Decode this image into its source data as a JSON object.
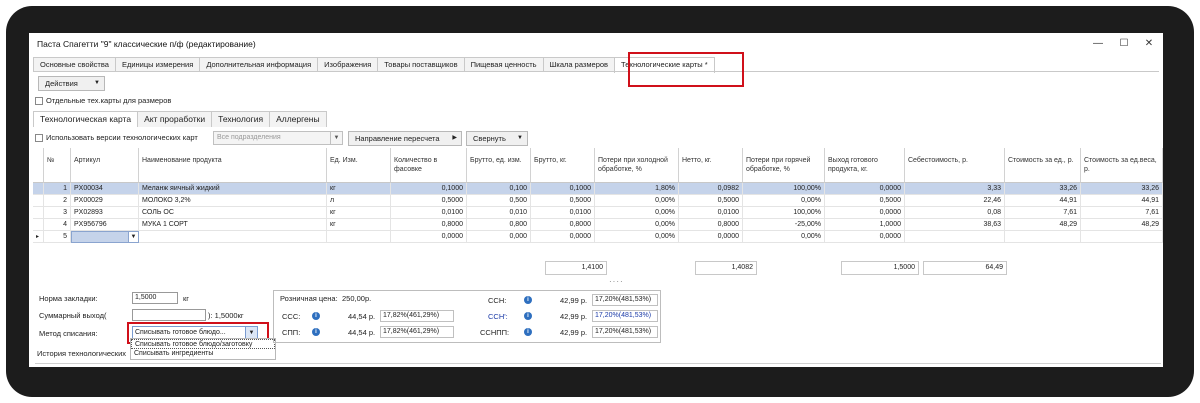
{
  "window": {
    "title": "Паста Спагетти \"9\" классические п/ф (редактирование)",
    "minimize": "—",
    "maximize": "☐",
    "close": "✕"
  },
  "tabs": [
    "Основные свойства",
    "Единицы измерения",
    "Дополнительная информация",
    "Изображения",
    "Товары поставщиков",
    "Пищевая ценность",
    "Шкала размеров",
    "Технологические карты *"
  ],
  "actions_label": "Действия",
  "size_cards_label": "Отдельные тех.карты для размеров",
  "subtabs": [
    "Технологическая карта",
    "Акт проработки",
    "Технология",
    "Аллергены"
  ],
  "use_versions_label": "Использовать версии технологических карт",
  "division_placeholder": "Все подразделения",
  "recalc_button": "Направление пересчета",
  "collapse_button": "Свернуть",
  "columns": [
    "№",
    "Артикул",
    "Наименование продукта",
    "Ед. Изм.",
    "Количество в фасовке",
    "Брутто, ед. изм.",
    "Брутто, кг.",
    "Потери при холодной обработке, %",
    "Нетто, кг.",
    "Потери при горячей обработке, %",
    "Выход готового продукта, кг.",
    "Себестоимость, р.",
    "Стоимость за ед., р.",
    "Стоимость за ед.веса, р."
  ],
  "rows": [
    {
      "n": "1",
      "art": "PX00034",
      "name": "Меланж яичный жидкий",
      "unit": "кг",
      "qty": "0,1000",
      "brutto_u": "0,100",
      "brutto": "0,1000",
      "cold": "1,80%",
      "netto": "0,0982",
      "hot": "100,00%",
      "out": "0,0000",
      "cost": "3,33",
      "price_u": "33,26",
      "price_w": "33,26"
    },
    {
      "n": "2",
      "art": "PX00029",
      "name": "МОЛОКО 3,2%",
      "unit": "л",
      "qty": "0,5000",
      "brutto_u": "0,500",
      "brutto": "0,5000",
      "cold": "0,00%",
      "netto": "0,5000",
      "hot": "0,00%",
      "out": "0,5000",
      "cost": "22,46",
      "price_u": "44,91",
      "price_w": "44,91"
    },
    {
      "n": "3",
      "art": "PX02893",
      "name": "СОЛЬ ОС",
      "unit": "кг",
      "qty": "0,0100",
      "brutto_u": "0,010",
      "brutto": "0,0100",
      "cold": "0,00%",
      "netto": "0,0100",
      "hot": "100,00%",
      "out": "0,0000",
      "cost": "0,08",
      "price_u": "7,61",
      "price_w": "7,61"
    },
    {
      "n": "4",
      "art": "PX956796",
      "name": "МУКА 1 СОРТ",
      "unit": "кг",
      "qty": "0,8000",
      "brutto_u": "0,800",
      "brutto": "0,8000",
      "cold": "0,00%",
      "netto": "0,8000",
      "hot": "-25,00%",
      "out": "1,0000",
      "cost": "38,63",
      "price_u": "48,29",
      "price_w": "48,29"
    },
    {
      "n": "5",
      "art": "",
      "name": "",
      "unit": "",
      "qty": "0,0000",
      "brutto_u": "0,000",
      "brutto": "0,0000",
      "cold": "0,00%",
      "netto": "0,0000",
      "hot": "0,00%",
      "out": "0,0000",
      "cost": "",
      "price_u": "",
      "price_w": ""
    }
  ],
  "totals": {
    "brutto": "1,4100",
    "netto": "1,4082",
    "out": "1,5000",
    "cost": "64,49"
  },
  "form": {
    "norma_label": "Норма закладки:",
    "norma_value": "1,5000",
    "norma_unit": "кг",
    "sum_label": "Суммарный выход(",
    "sum_value": "): 1,5000кг",
    "method_label": "Метод списания:",
    "method_value": "Списывать готовое блюдо...",
    "history_label": "История технологических"
  },
  "dropdown_options": [
    "Списывать готовое блюдо/заготовку",
    "Списывать ингредиенты"
  ],
  "prices": {
    "retail_label": "Розничная цена:",
    "retail_value": "250,00р.",
    "sss_label": "ССС:",
    "sss_value": "44,54 р.",
    "sss_pct": "17,82%(461,29%)",
    "spp_label": "СПП:",
    "spp_value": "44,54 р.",
    "spp_pct": "17,82%(461,29%)",
    "ssn_label": "ССН:",
    "ssn_value": "42,99 р.",
    "ssn_pct": "17,20%(481,53%)",
    "ssn2_label": "ССН':",
    "ssn2_value": "42,99 р.",
    "ssn2_pct": "17,20%(481,53%)",
    "ssnpp_label": "ССНПП:",
    "ssnpp_value": "42,99 р.",
    "ssnpp_pct": "17,20%(481,53%)"
  },
  "colors": {
    "accent_red": "#d0101a",
    "selection": "#c5d3ea",
    "info_blue": "#2e6fbf",
    "bezel": "#1c1c1c"
  }
}
